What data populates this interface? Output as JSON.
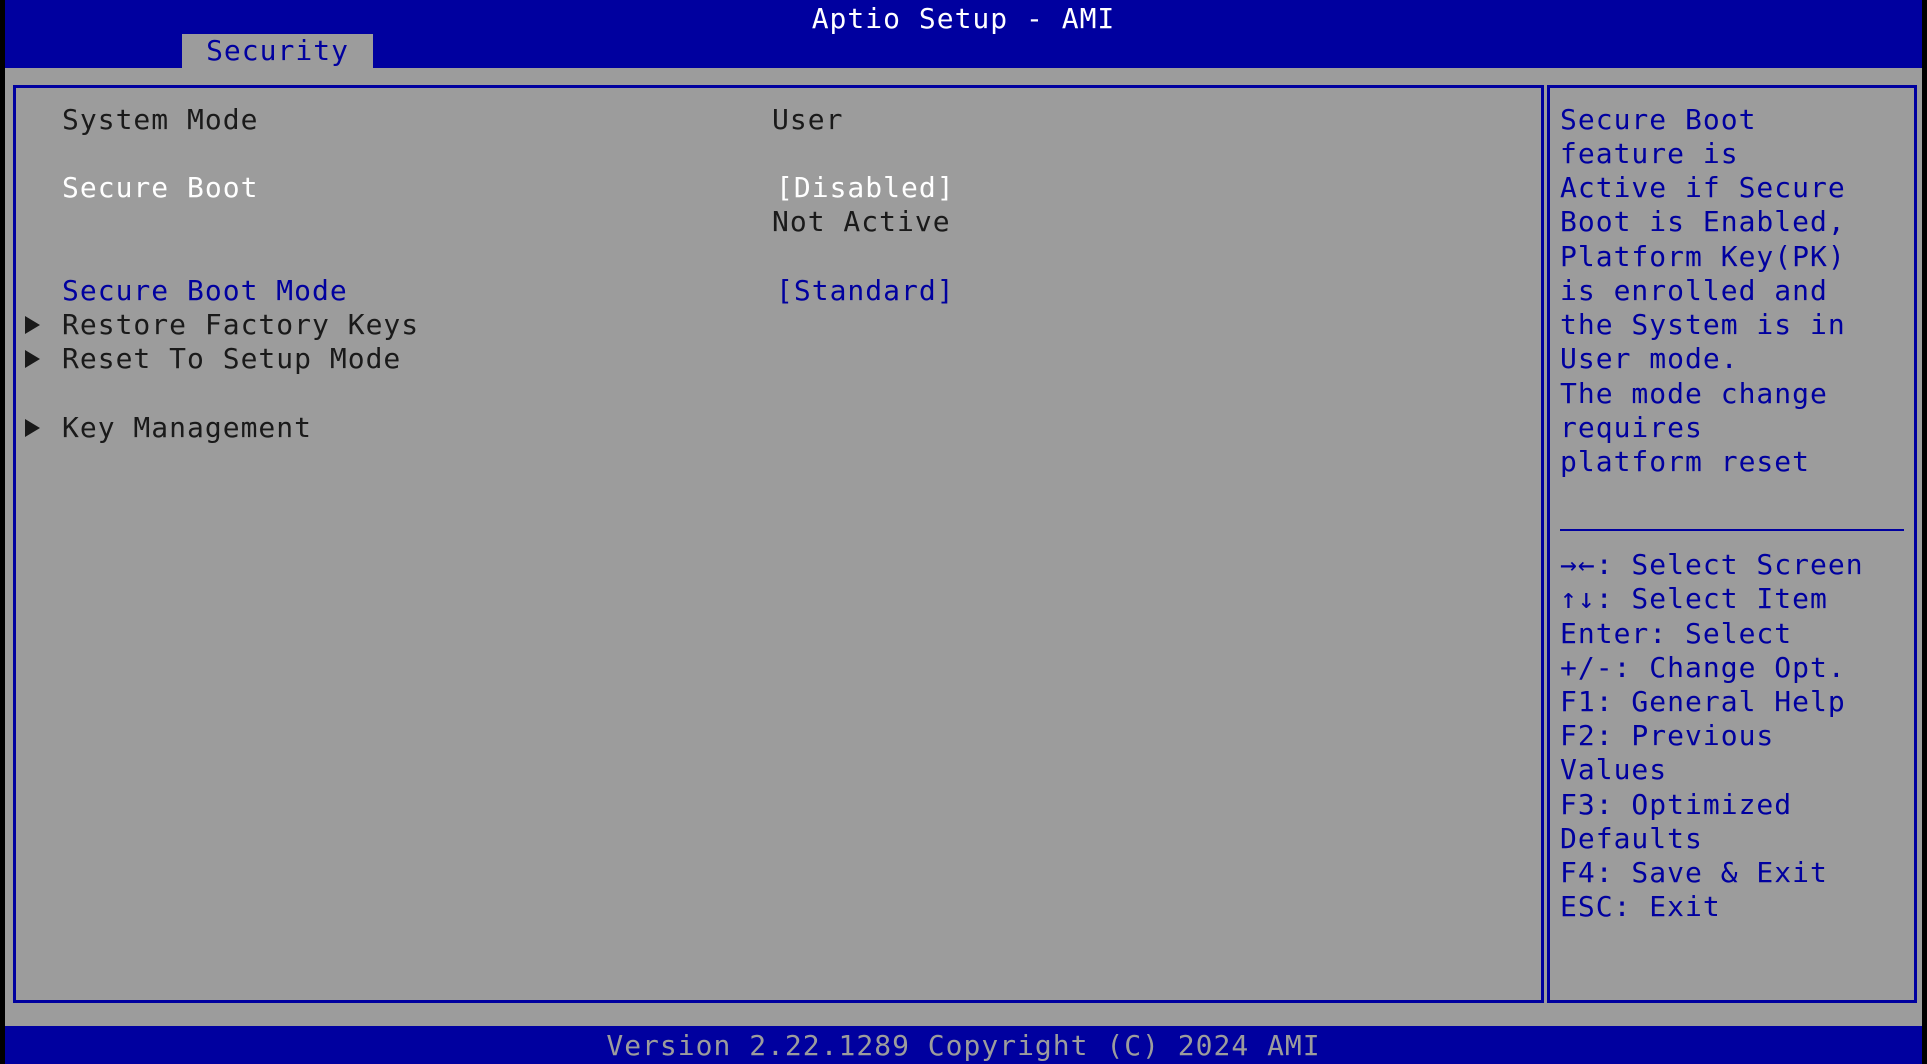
{
  "header": {
    "title": "Aptio Setup - AMI",
    "active_tab": "Security"
  },
  "main": {
    "system_mode": {
      "label": "System Mode",
      "value": "User"
    },
    "secure_boot": {
      "label": "Secure Boot",
      "value": "[Disabled]",
      "status": "Not Active"
    },
    "secure_boot_mode": {
      "label": "Secure Boot Mode",
      "value": "[Standard]"
    },
    "submenus": [
      {
        "label": "Restore Factory Keys"
      },
      {
        "label": "Reset To Setup Mode"
      },
      {
        "label": "Key Management"
      }
    ]
  },
  "help": {
    "description_lines": [
      "Secure Boot",
      "feature is",
      "Active if Secure",
      "Boot is Enabled,",
      "Platform Key(PK)",
      "is enrolled and",
      "the System is in",
      "User mode.",
      "The mode change",
      "requires",
      "platform reset"
    ],
    "key_lines": [
      "→←: Select Screen",
      "↑↓: Select Item",
      "Enter: Select",
      "+/-: Change Opt.",
      "F1: General Help",
      "F2: Previous",
      "Values",
      "F3: Optimized",
      "Defaults",
      "F4: Save & Exit",
      "ESC: Exit"
    ]
  },
  "footer": {
    "version_text": "Version 2.22.1289 Copyright (C) 2024 AMI"
  },
  "colors": {
    "background_gray": "#9c9c9c",
    "accent_blue": "#00009f",
    "highlight_white": "#ffffff",
    "text_dark": "#1a1a1a"
  },
  "icons": {
    "submenu_marker": "right-triangle-icon"
  }
}
